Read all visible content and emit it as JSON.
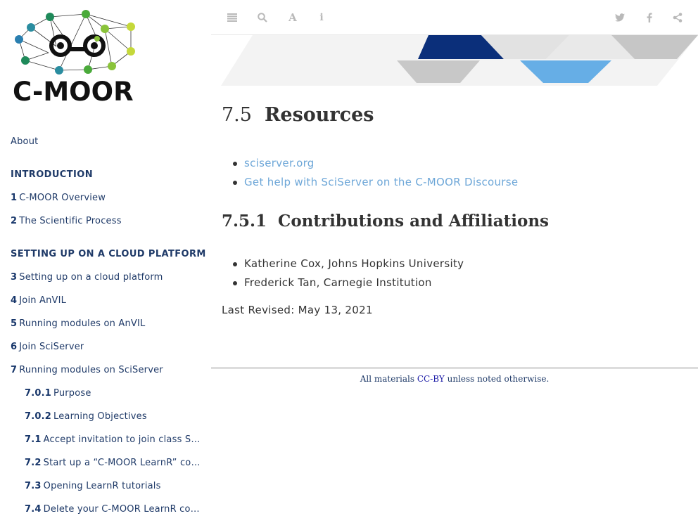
{
  "logo": {
    "text": "C-MOOR"
  },
  "sidebar": {
    "about": "About",
    "header_intro": "INTRODUCTION",
    "header_setup": "SETTING UP ON A CLOUD PLATFORM",
    "items": [
      {
        "num": "1",
        "label": "C-MOOR Overview"
      },
      {
        "num": "2",
        "label": "The Scientific Process"
      },
      {
        "num": "3",
        "label": "Setting up on a cloud platform"
      },
      {
        "num": "4",
        "label": "Join AnVIL"
      },
      {
        "num": "5",
        "label": "Running modules on AnVIL"
      },
      {
        "num": "6",
        "label": "Join SciServer"
      },
      {
        "num": "7",
        "label": "Running modules on SciServer"
      }
    ],
    "subitems": [
      {
        "num": "7.0.1",
        "label": "Purpose"
      },
      {
        "num": "7.0.2",
        "label": "Learning Objectives"
      },
      {
        "num": "7.1",
        "label": "Accept invitation to join class SciServer group"
      },
      {
        "num": "7.2",
        "label": "Start up a “C-MOOR LearnR” compute container"
      },
      {
        "num": "7.3",
        "label": "Opening LearnR tutorials"
      },
      {
        "num": "7.4",
        "label": "Delete your C-MOOR LearnR compute container"
      }
    ]
  },
  "toolbar": {
    "icons": [
      "list-icon",
      "search-icon",
      "font-icon",
      "info-icon",
      "twitter-icon",
      "facebook-icon",
      "share-icon"
    ]
  },
  "main": {
    "section_num": "7.5",
    "section_title": "Resources",
    "links": [
      "sciserver.org",
      "Get help with SciServer on the C-MOOR Discourse"
    ],
    "subsection_num": "7.5.1",
    "subsection_title": "Contributions and Affiliations",
    "contributors": [
      "Katherine Cox, Johns Hopkins University",
      "Frederick Tan, Carnegie Institution"
    ],
    "last_revised": "Last Revised: May 13, 2021"
  },
  "footer": {
    "prefix": "All materials ",
    "license": "CC-BY",
    "suffix": " unless noted otherwise."
  },
  "colors": {
    "nav_text": "#1f3a68",
    "link": "#6ea7d8",
    "banner_dark": "#0b2f7a",
    "banner_light_blue": "#66aee6"
  }
}
